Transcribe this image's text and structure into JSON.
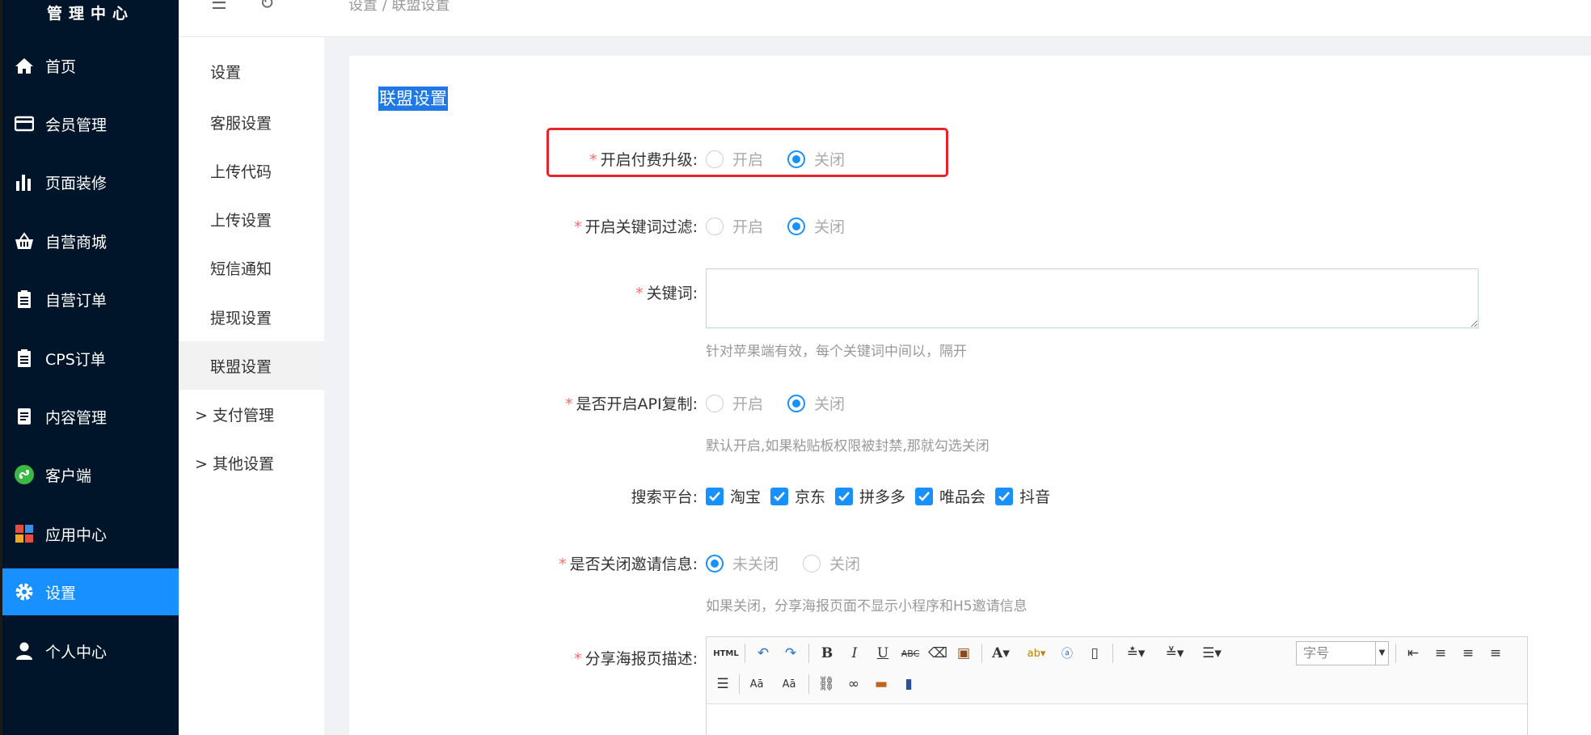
{
  "sidebar": {
    "brand": "管理中心",
    "items": [
      {
        "label": "首页",
        "icon": "home-icon"
      },
      {
        "label": "会员管理",
        "icon": "card-icon"
      },
      {
        "label": "页面装修",
        "icon": "bar-chart-icon"
      },
      {
        "label": "自营商城",
        "icon": "basket-icon"
      },
      {
        "label": "自营订单",
        "icon": "clipboard-icon"
      },
      {
        "label": "CPS订单",
        "icon": "clipboard-icon"
      },
      {
        "label": "内容管理",
        "icon": "document-icon"
      },
      {
        "label": "客户端",
        "icon": "mini-program-icon"
      },
      {
        "label": "应用中心",
        "icon": "apps-icon"
      },
      {
        "label": "设置",
        "icon": "gear-icon",
        "active": true
      },
      {
        "label": "个人中心",
        "icon": "user-icon"
      }
    ],
    "active_color": "#1890ff"
  },
  "header": {
    "breadcrumb": "设置  /  联盟设置"
  },
  "subnav": {
    "items": [
      {
        "label": "设置"
      },
      {
        "label": "客服设置"
      },
      {
        "label": "上传代码"
      },
      {
        "label": "上传设置"
      },
      {
        "label": "短信通知"
      },
      {
        "label": "提现设置"
      },
      {
        "label": "联盟设置",
        "active": true
      },
      {
        "label": "> 支付管理"
      },
      {
        "label": "> 其他设置"
      }
    ]
  },
  "form": {
    "title": "联盟设置",
    "paid_upgrade": {
      "label": "开启付费升级:",
      "options": [
        "开启",
        "关闭"
      ],
      "selected": "关闭"
    },
    "keyword_filter": {
      "label": "开启关键词过滤:",
      "options": [
        "开启",
        "关闭"
      ],
      "selected": "关闭"
    },
    "keywords": {
      "label": "关键词:",
      "value": "",
      "hint": "针对苹果端有效，每个关键词中间以，隔开"
    },
    "api_copy": {
      "label": "是否开启API复制:",
      "options": [
        "开启",
        "关闭"
      ],
      "selected": "关闭",
      "hint": "默认开启,如果粘贴板权限被封禁,那就勾选关闭"
    },
    "search_platform": {
      "label": "搜索平台:",
      "options": [
        "淘宝",
        "京东",
        "拼多多",
        "唯品会",
        "抖音"
      ]
    },
    "invite_info": {
      "label": "是否关闭邀请信息:",
      "options": [
        "未关闭",
        "关闭"
      ],
      "selected": "未关闭",
      "hint": "如果关闭，分享海报页面不显示小程序和H5邀请信息"
    },
    "poster_desc": {
      "label": "分享海报页描述:",
      "fontsize_placeholder": "字号"
    }
  },
  "colors": {
    "accent": "#1890ff",
    "required": "#f56c6c",
    "highlight_border": "#e8242b",
    "sidebar_bg": "#001529"
  }
}
